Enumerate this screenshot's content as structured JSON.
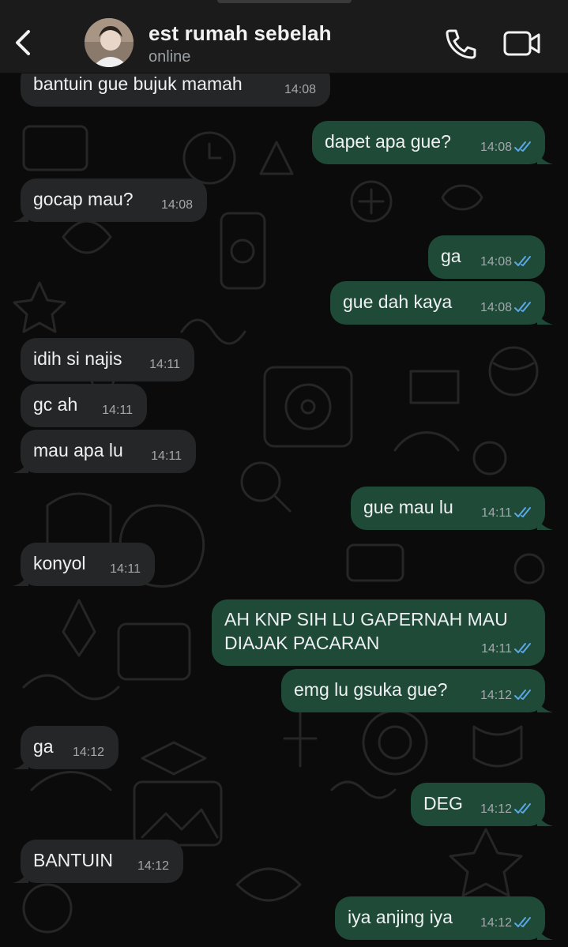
{
  "header": {
    "contact_name": "est rumah sebelah",
    "status": "online"
  },
  "colors": {
    "incoming_bubble": "#252627",
    "outgoing_bubble": "#1f4a38",
    "read_ticks": "#5aa8e6",
    "header_bg": "#1b1b1b"
  },
  "messages": [
    {
      "direction": "in",
      "text": "bantuin gue bujuk mamah",
      "time": "14:08"
    },
    {
      "direction": "out",
      "text": "dapet apa gue?",
      "time": "14:08",
      "status": "read"
    },
    {
      "direction": "in",
      "text": "gocap mau?",
      "time": "14:08"
    },
    {
      "direction": "out",
      "text": "ga",
      "time": "14:08",
      "status": "read"
    },
    {
      "direction": "out",
      "text": "gue dah kaya",
      "time": "14:08",
      "status": "read"
    },
    {
      "direction": "in",
      "text": "idih si najis",
      "time": "14:11"
    },
    {
      "direction": "in",
      "text": "gc ah",
      "time": "14:11"
    },
    {
      "direction": "in",
      "text": "mau apa lu",
      "time": "14:11"
    },
    {
      "direction": "out",
      "text": "gue mau lu",
      "time": "14:11",
      "status": "read"
    },
    {
      "direction": "in",
      "text": "konyol",
      "time": "14:11"
    },
    {
      "direction": "out",
      "text": "AH KNP SIH LU GAPERNAH MAU DIAJAK PACARAN",
      "time": "14:11",
      "status": "read"
    },
    {
      "direction": "out",
      "text": "emg lu gsuka gue?",
      "time": "14:12",
      "status": "read"
    },
    {
      "direction": "in",
      "text": "ga",
      "time": "14:12"
    },
    {
      "direction": "out",
      "text": "DEG",
      "time": "14:12",
      "status": "read"
    },
    {
      "direction": "in",
      "text": "BANTUIN",
      "time": "14:12"
    },
    {
      "direction": "out",
      "text": "iya anjing iya",
      "time": "14:12",
      "status": "read"
    }
  ]
}
